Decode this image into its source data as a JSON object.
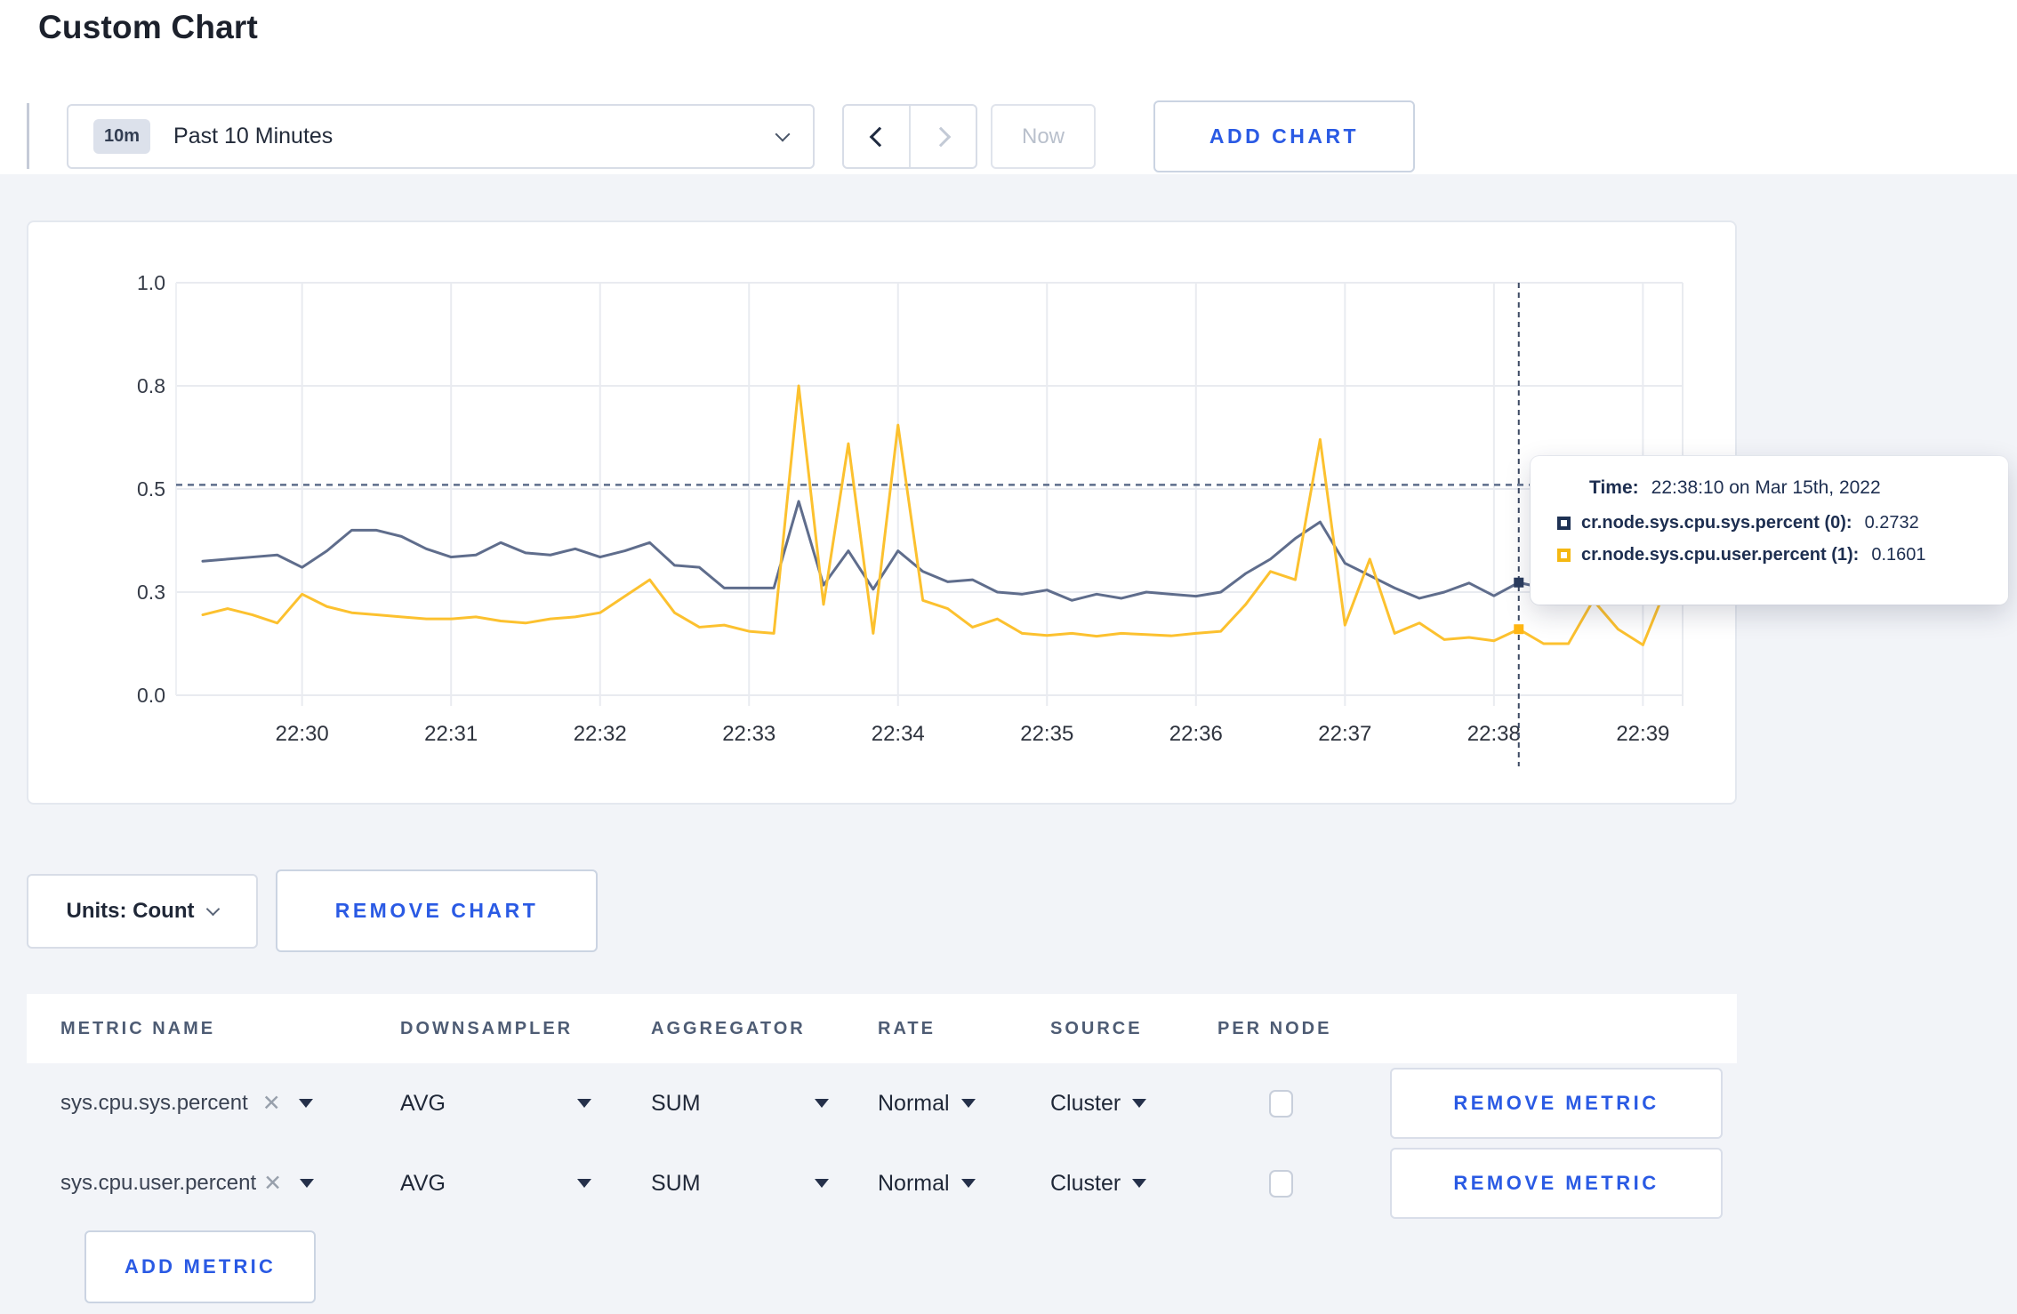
{
  "page": {
    "title": "Custom Chart"
  },
  "toolbar": {
    "range_badge": "10m",
    "range_label": "Past 10 Minutes",
    "now_label": "Now",
    "add_chart_label": "ADD CHART"
  },
  "chart_data": {
    "type": "line",
    "title": "",
    "xlabel": "",
    "ylabel": "",
    "ylim": [
      0,
      1
    ],
    "grid": true,
    "legend_position": "none",
    "yticks": [
      {
        "v": 0,
        "label": "0.0"
      },
      {
        "v": 0.25,
        "label": "0.3"
      },
      {
        "v": 0.5,
        "label": "0.5"
      },
      {
        "v": 0.75,
        "label": "0.8"
      },
      {
        "v": 1,
        "label": "1.0"
      }
    ],
    "xticks": [
      "22:30",
      "22:31",
      "22:32",
      "22:33",
      "22:34",
      "22:35",
      "22:36",
      "22:37",
      "22:38",
      "22:39"
    ],
    "x": [
      "22:29:20",
      "22:29:30",
      "22:29:40",
      "22:29:50",
      "22:30:00",
      "22:30:10",
      "22:30:20",
      "22:30:30",
      "22:30:40",
      "22:30:50",
      "22:31:00",
      "22:31:10",
      "22:31:20",
      "22:31:30",
      "22:31:40",
      "22:31:50",
      "22:32:00",
      "22:32:10",
      "22:32:20",
      "22:32:30",
      "22:32:40",
      "22:32:50",
      "22:33:00",
      "22:33:10",
      "22:33:20",
      "22:33:30",
      "22:33:40",
      "22:33:50",
      "22:34:00",
      "22:34:10",
      "22:34:20",
      "22:34:30",
      "22:34:40",
      "22:34:50",
      "22:35:00",
      "22:35:10",
      "22:35:20",
      "22:35:30",
      "22:35:40",
      "22:35:50",
      "22:36:00",
      "22:36:10",
      "22:36:20",
      "22:36:30",
      "22:36:40",
      "22:36:50",
      "22:37:00",
      "22:37:10",
      "22:37:20",
      "22:37:30",
      "22:37:40",
      "22:37:50",
      "22:38:00",
      "22:38:10",
      "22:38:20",
      "22:38:30",
      "22:38:40",
      "22:38:50",
      "22:39:00",
      "22:39:10"
    ],
    "series": [
      {
        "name": "cr.node.sys.cpu.sys.percent",
        "color": "#5F6D8C",
        "values": [
          0.325,
          0.33,
          0.335,
          0.34,
          0.31,
          0.35,
          0.4,
          0.4,
          0.385,
          0.355,
          0.335,
          0.34,
          0.37,
          0.345,
          0.34,
          0.355,
          0.335,
          0.35,
          0.37,
          0.315,
          0.31,
          0.26,
          0.26,
          0.26,
          0.47,
          0.267,
          0.35,
          0.257,
          0.35,
          0.3,
          0.275,
          0.28,
          0.25,
          0.245,
          0.255,
          0.23,
          0.245,
          0.235,
          0.25,
          0.245,
          0.24,
          0.25,
          0.295,
          0.33,
          0.38,
          0.42,
          0.32,
          0.29,
          0.26,
          0.235,
          0.25,
          0.272,
          0.241,
          0.2732,
          0.26,
          0.28,
          0.29,
          0.285,
          0.28,
          0.3
        ]
      },
      {
        "name": "cr.node.sys.cpu.user.percent",
        "color": "#FCC12F",
        "values": [
          0.195,
          0.21,
          0.195,
          0.175,
          0.245,
          0.215,
          0.2,
          0.195,
          0.19,
          0.185,
          0.185,
          0.19,
          0.18,
          0.175,
          0.185,
          0.19,
          0.2,
          0.24,
          0.28,
          0.2,
          0.165,
          0.17,
          0.155,
          0.15,
          0.75,
          0.22,
          0.61,
          0.15,
          0.655,
          0.23,
          0.21,
          0.165,
          0.185,
          0.15,
          0.145,
          0.15,
          0.143,
          0.15,
          0.147,
          0.144,
          0.15,
          0.155,
          0.22,
          0.3,
          0.28,
          0.62,
          0.17,
          0.33,
          0.15,
          0.175,
          0.135,
          0.14,
          0.132,
          0.1601,
          0.125,
          0.125,
          0.23,
          0.16,
          0.122,
          0.27
        ]
      }
    ],
    "threshold_dashed_line": 0.51,
    "crosshair": {
      "x": "22:38:10",
      "values": [
        0.2732,
        0.1601
      ],
      "dot_colors": [
        "#2B3C5E",
        "#FFB613"
      ]
    }
  },
  "tooltip": {
    "time_label": "Time:",
    "time_value": "22:38:10 on Mar 15th, 2022",
    "series": [
      {
        "name": "cr.node.sys.cpu.sys.percent (0):",
        "value": "0.2732",
        "color": "#1F3254"
      },
      {
        "name": "cr.node.sys.cpu.user.percent (1):",
        "value": "0.1601",
        "color": "#F5B812"
      }
    ]
  },
  "controls": {
    "units_label": "Units: Count",
    "remove_chart_label": "REMOVE CHART",
    "add_metric_label": "ADD METRIC"
  },
  "table": {
    "headers": [
      "METRIC NAME",
      "DOWNSAMPLER",
      "AGGREGATOR",
      "RATE",
      "SOURCE",
      "PER NODE"
    ],
    "rows": [
      {
        "metric": "sys.cpu.sys.percent",
        "downsampler": "AVG",
        "aggregator": "SUM",
        "rate": "Normal",
        "source": "Cluster",
        "per_node_checked": false,
        "remove_label": "REMOVE METRIC"
      },
      {
        "metric": "sys.cpu.user.percent",
        "downsampler": "AVG",
        "aggregator": "SUM",
        "rate": "Normal",
        "source": "Cluster",
        "per_node_checked": false,
        "remove_label": "REMOVE METRIC"
      }
    ]
  },
  "colors": {
    "accent_blue": "#2A5AE4",
    "page_background": "#F2F4F8",
    "gridline": "#E9EBF0"
  }
}
